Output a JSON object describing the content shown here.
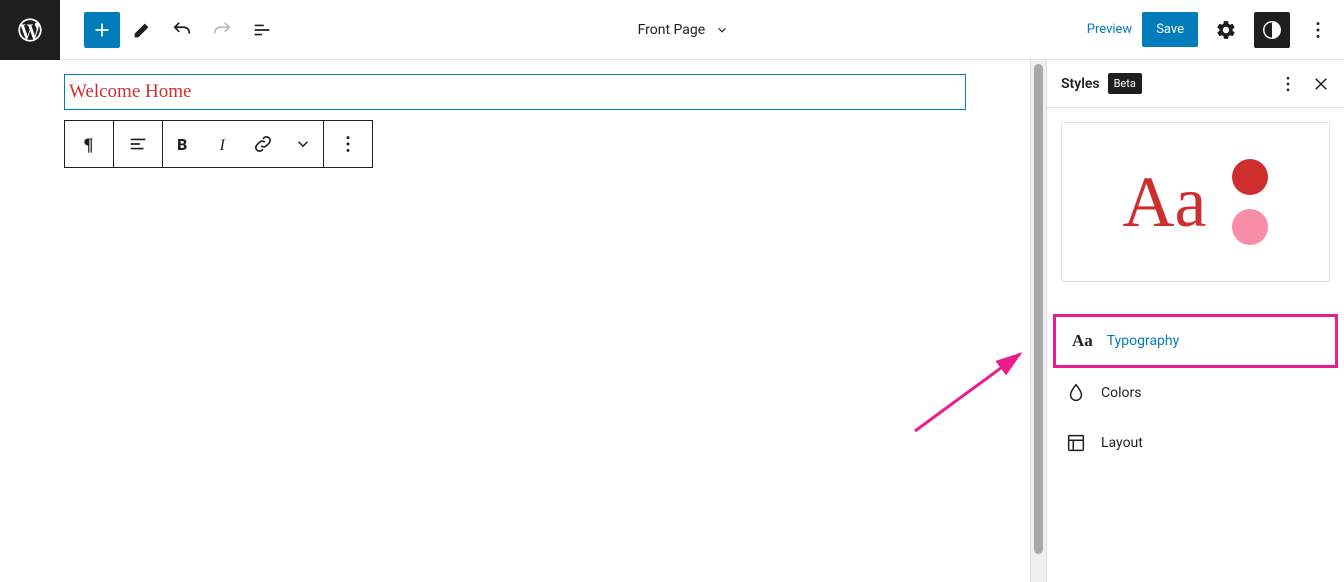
{
  "header": {
    "page_title": "Front Page",
    "preview_label": "Preview",
    "save_label": "Save"
  },
  "canvas": {
    "paragraph_text": "Welcome Home"
  },
  "sidebar": {
    "title": "Styles",
    "badge": "Beta",
    "preview_sample": "Aa",
    "colors": {
      "primary": "#cf2e2e",
      "secondary": "#f78da7"
    },
    "items": [
      {
        "icon": "aa",
        "label": "Typography"
      },
      {
        "icon": "drop",
        "label": "Colors"
      },
      {
        "icon": "layout",
        "label": "Layout"
      }
    ]
  }
}
